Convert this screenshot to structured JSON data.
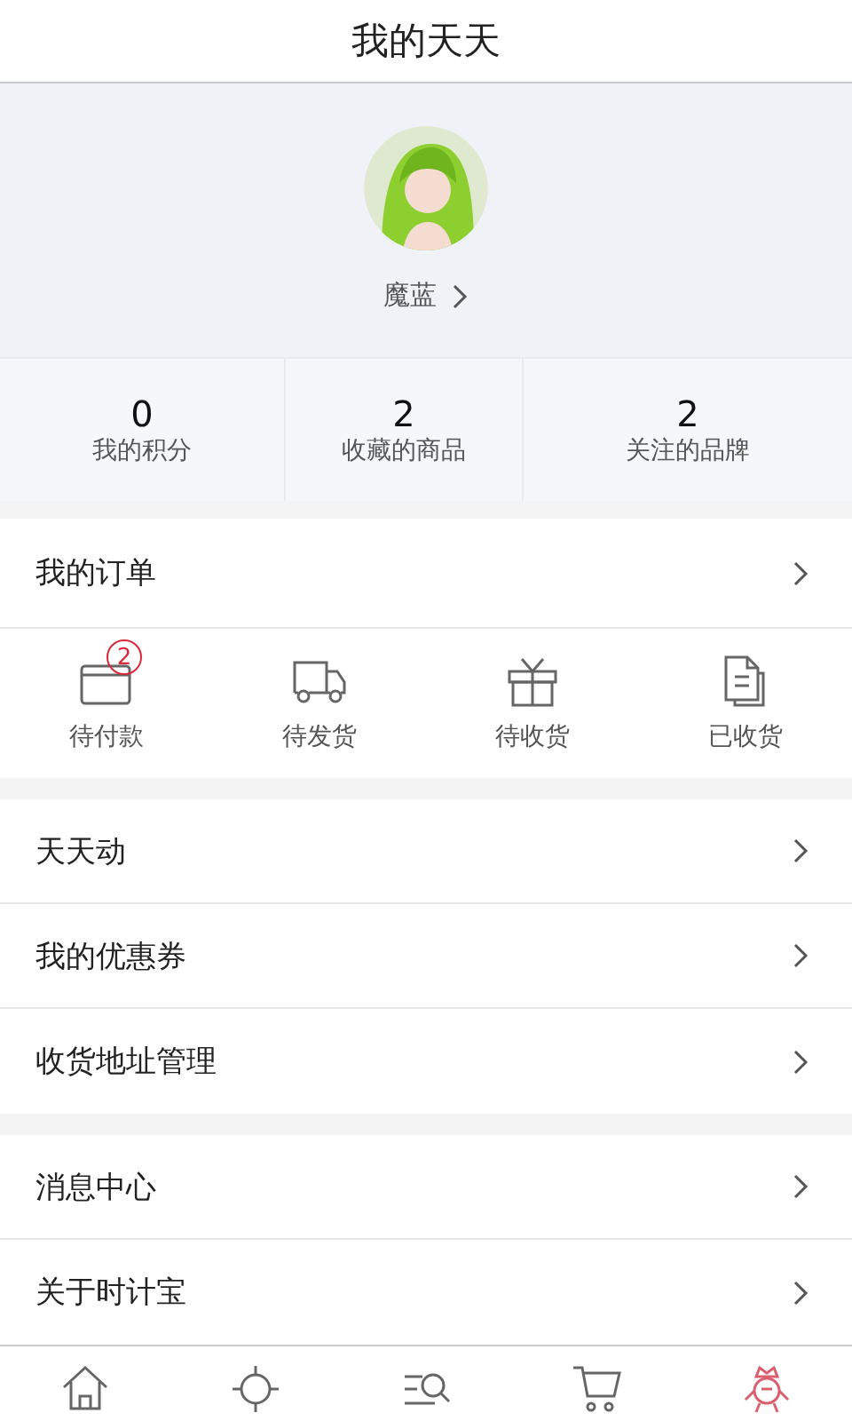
{
  "header": {
    "title": "我的天天"
  },
  "profile": {
    "name": "魔蓝"
  },
  "stats": [
    {
      "value": "0",
      "label": "我的积分"
    },
    {
      "value": "2",
      "label": "收藏的商品"
    },
    {
      "value": "2",
      "label": "关注的品牌"
    }
  ],
  "orders": {
    "title": "我的订单",
    "items": [
      {
        "kind": "wallet",
        "label": "待付款",
        "badge": "2"
      },
      {
        "kind": "truck",
        "label": "待发货"
      },
      {
        "kind": "gift",
        "label": "待收货"
      },
      {
        "kind": "document",
        "label": "已收货"
      }
    ]
  },
  "menu_groups": [
    [
      {
        "label": "天天动"
      },
      {
        "label": "我的优惠券"
      },
      {
        "label": "收货地址管理"
      }
    ],
    [
      {
        "label": "消息中心"
      },
      {
        "label": "关于时计宝"
      }
    ]
  ],
  "tab_bar": [
    {
      "kind": "home",
      "selected": false
    },
    {
      "kind": "sun",
      "selected": false
    },
    {
      "kind": "search",
      "selected": false
    },
    {
      "kind": "cart",
      "selected": false
    },
    {
      "kind": "mascot",
      "selected": true
    }
  ]
}
